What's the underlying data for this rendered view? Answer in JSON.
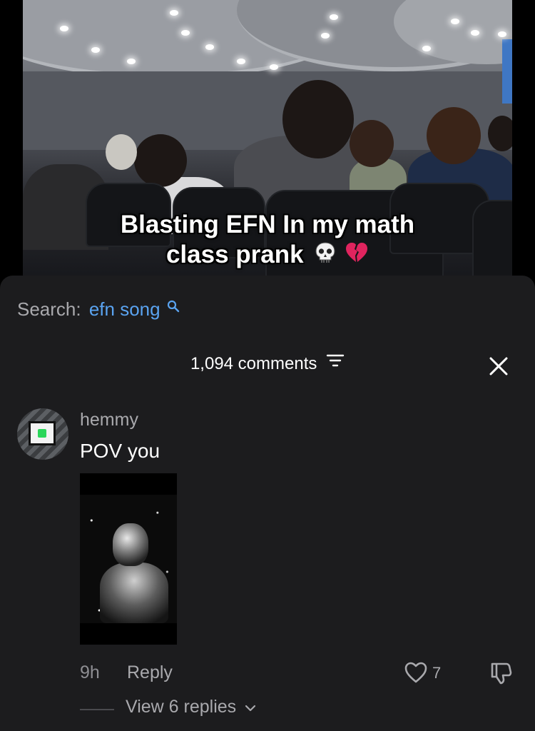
{
  "video": {
    "caption_line1": "Blasting EFN In my math",
    "caption_line2": "class prank",
    "caption_emojis": [
      "skull-emoji",
      "broken-heart-emoji"
    ]
  },
  "search": {
    "label": "Search:",
    "term": "efn song"
  },
  "comments": {
    "count_label": "1,094 comments"
  },
  "comment": {
    "username": "hemmy",
    "text": "POV you",
    "time": "9h",
    "reply_label": "Reply",
    "like_count": "7",
    "view_replies_label": "View 6 replies"
  },
  "colors": {
    "sheet_bg": "#1c1c1e",
    "search_term": "#5aa3f0",
    "muted_text": "#a9a9ad"
  }
}
